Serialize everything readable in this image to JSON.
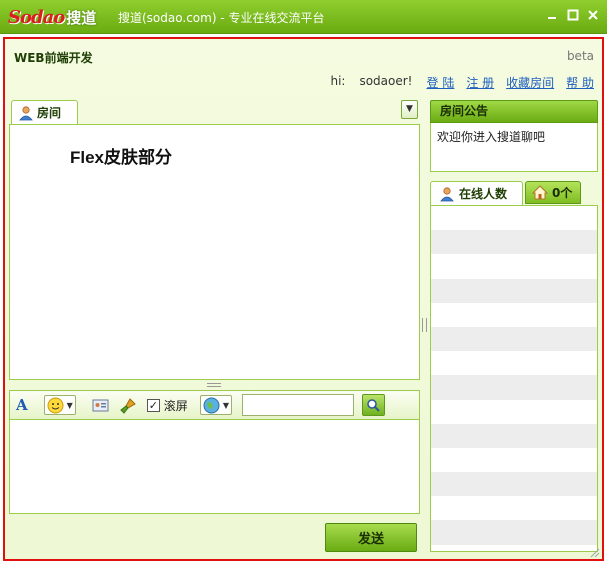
{
  "window": {
    "logo_text": "Sodao",
    "logo_cn": "搜道",
    "title": "搜道(sodao.com) - 专业在线交流平台"
  },
  "app": {
    "title": "WEB前端开发",
    "version_tag": "beta"
  },
  "userbar": {
    "greeting": "hi:",
    "username": "sodaoer!",
    "links": [
      "登 陆",
      "注 册",
      "收藏房间",
      "帮 助"
    ]
  },
  "room": {
    "tab_label": "房间",
    "content": "Flex皮肤部分"
  },
  "toolbar": {
    "scroll_label": "滚屏",
    "scroll_checked": true,
    "search_value": ""
  },
  "send_button": "发送",
  "notice": {
    "title": "房间公告",
    "body": "欢迎你进入搜道聊吧"
  },
  "online": {
    "tab_label": "在线人数",
    "count_label": "0个",
    "rows": 14
  },
  "colors": {
    "accent_green": "#6aab12",
    "highlight_red": "#e01010",
    "link_blue": "#1f5fbf"
  },
  "icons": [
    "user-icon",
    "font-icon",
    "smiley-icon",
    "id-card-icon",
    "brush-icon",
    "globe-icon",
    "search-icon",
    "home-icon",
    "minimize-icon",
    "maximize-icon",
    "close-icon"
  ]
}
